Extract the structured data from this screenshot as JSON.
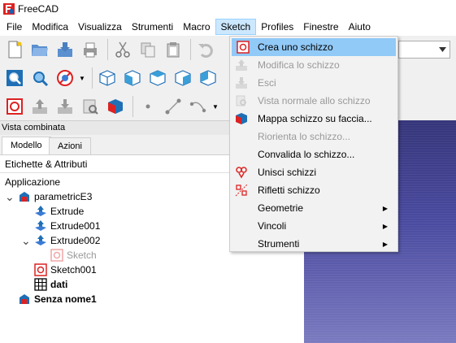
{
  "window": {
    "title": "FreeCAD"
  },
  "menubar": [
    "File",
    "Modifica",
    "Visualizza",
    "Strumenti",
    "Macro",
    "Sketch",
    "Profiles",
    "Finestre",
    "Aiuto"
  ],
  "active_menu": "Sketch",
  "sketch_menu": [
    {
      "label": "Crea uno schizzo",
      "state": "highlighted",
      "icon": "create-sketch-icon"
    },
    {
      "label": "Modifica lo schizzo",
      "state": "disabled",
      "icon": "edit-sketch-icon"
    },
    {
      "label": "Esci",
      "state": "disabled",
      "icon": "leave-sketch-icon"
    },
    {
      "label": "Vista normale allo schizzo",
      "state": "disabled",
      "icon": "view-sketch-icon"
    },
    {
      "label": "Mappa schizzo su faccia...",
      "state": "enabled",
      "icon": "map-sketch-icon"
    },
    {
      "label": "Riorienta lo schizzo...",
      "state": "disabled",
      "icon": ""
    },
    {
      "label": "Convalida lo schizzo...",
      "state": "enabled",
      "icon": ""
    },
    {
      "label": "Unisci schizzi",
      "state": "enabled",
      "icon": "merge-sketches-icon"
    },
    {
      "label": "Rifletti schizzo",
      "state": "enabled",
      "icon": "mirror-sketch-icon"
    },
    {
      "label": "Geometrie",
      "state": "submenu",
      "icon": ""
    },
    {
      "label": "Vincoli",
      "state": "submenu",
      "icon": ""
    },
    {
      "label": "Strumenti",
      "state": "submenu",
      "icon": ""
    }
  ],
  "panel": {
    "title": "Vista combinata",
    "tabs": [
      "Modello",
      "Azioni"
    ],
    "active_tab": "Modello",
    "tree_header": "Etichette & Attributi",
    "section": "Applicazione"
  },
  "tree": [
    {
      "label": "parametricE3",
      "level": 0,
      "expander": "open",
      "icon": "document-icon",
      "style": "normal"
    },
    {
      "label": "Extrude",
      "level": 1,
      "expander": "",
      "icon": "extrude-icon",
      "style": "normal"
    },
    {
      "label": "Extrude001",
      "level": 1,
      "expander": "",
      "icon": "extrude-icon",
      "style": "normal"
    },
    {
      "label": "Extrude002",
      "level": 1,
      "expander": "open",
      "icon": "extrude-icon",
      "style": "normal"
    },
    {
      "label": "Sketch",
      "level": 2,
      "expander": "",
      "icon": "sketch-icon",
      "style": "muted"
    },
    {
      "label": "Sketch001",
      "level": 1,
      "expander": "",
      "icon": "sketch-icon",
      "style": "normal"
    },
    {
      "label": "dati",
      "level": 1,
      "expander": "",
      "icon": "spreadsheet-icon",
      "style": "bold"
    },
    {
      "label": "Senza nome1",
      "level": 0,
      "expander": "",
      "icon": "document-icon",
      "style": "bold"
    }
  ],
  "colors": {
    "menu_highlight": "#91c9f7",
    "menubar_active": "#cce8ff",
    "viewport_top": "#35357a",
    "viewport_bottom": "#7a7ac0"
  }
}
